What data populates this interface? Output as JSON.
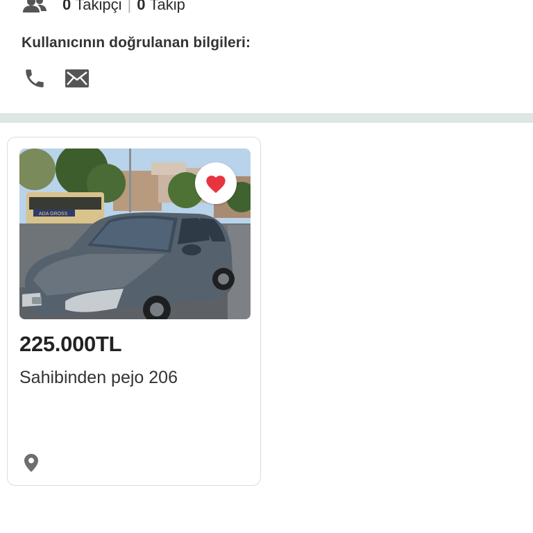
{
  "profile": {
    "followers_count": "0",
    "followers_label": "Takipçi",
    "separator": "|",
    "following_count": "0",
    "following_label": "Takip",
    "followers_icon": "users-icon",
    "verified_title": "Kullanıcının doğrulanan bilgileri:",
    "verified_items": [
      {
        "icon": "phone-icon"
      },
      {
        "icon": "email-icon"
      }
    ]
  },
  "listing": {
    "price": "225.000TL",
    "title": "Sahibinden pejo 206",
    "favorite_icon": "heart-icon",
    "favorite_color": "#e8343f",
    "location_icon": "location-pin-icon",
    "photo_sign_text": "ADA GROSS"
  },
  "colors": {
    "divider": "#dde6e3",
    "icon_gray": "#555555",
    "card_border": "#dcdcdc"
  }
}
